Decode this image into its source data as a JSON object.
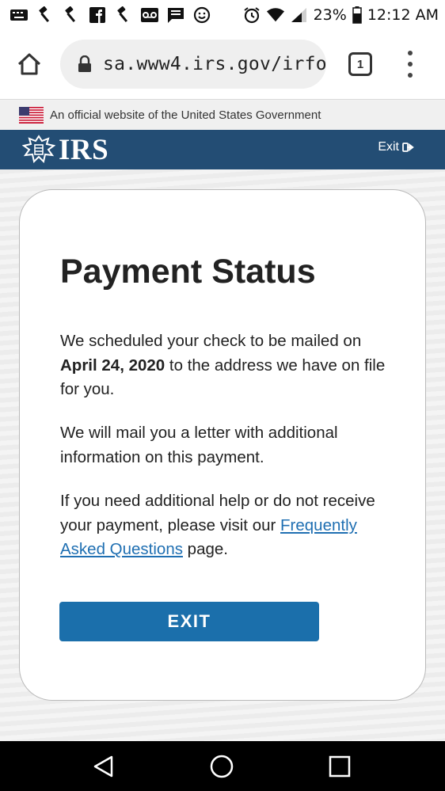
{
  "status_bar": {
    "battery": "23%",
    "time": "12:12 AM"
  },
  "browser": {
    "url": "sa.www4.irs.gov/irfo",
    "tab_count": "1"
  },
  "gov_banner": {
    "text": "An official website of the United States Government"
  },
  "header": {
    "logo_text": "IRS",
    "exit_label": "Exit"
  },
  "card": {
    "title": "Payment Status",
    "para1_before": "We scheduled your check to be mailed on ",
    "para1_date": "April 24, 2020",
    "para1_after": " to the address we have on file for you.",
    "para2": "We will mail you a letter with additional information on this payment.",
    "para3_before": "If you need additional help or do not receive your payment, please visit our ",
    "para3_link": "Frequently Asked Questions",
    "para3_after": " page.",
    "exit_button": "EXIT"
  },
  "icons": {
    "status_left": [
      "keyboard-icon",
      "gavel-icon",
      "gavel-icon",
      "facebook-icon",
      "gavel-icon",
      "voicemail-icon",
      "message-icon",
      "smiley-icon"
    ],
    "status_right": [
      "alarm-icon",
      "wifi-icon",
      "signal-icon",
      "battery-icon"
    ],
    "nav": [
      "back-icon",
      "home-icon",
      "recents-icon"
    ]
  },
  "colors": {
    "irs_blue": "#234d74",
    "button_blue": "#1b6fab",
    "link_blue": "#1f6fb2"
  }
}
